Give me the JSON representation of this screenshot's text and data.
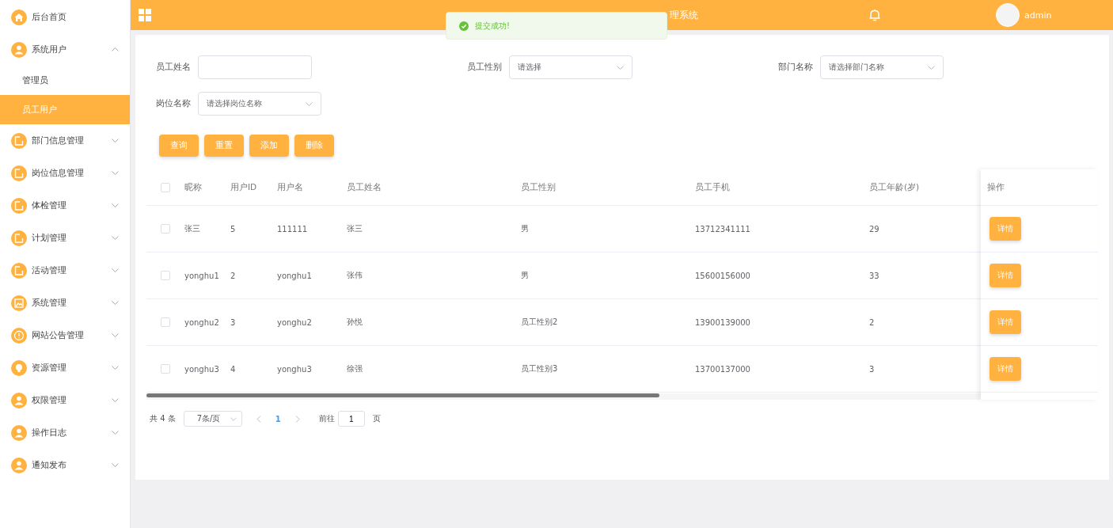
{
  "sidebar": {
    "items": [
      {
        "label": "后台首页",
        "kind": "home"
      },
      {
        "label": "系统用户",
        "kind": "user",
        "expanded": true,
        "children": [
          {
            "label": "管理员",
            "selected": false
          },
          {
            "label": "员工用户",
            "selected": true
          }
        ]
      },
      {
        "label": "部门信息管理",
        "kind": "note",
        "expanded": false
      },
      {
        "label": "岗位信息管理",
        "kind": "note",
        "expanded": false
      },
      {
        "label": "体检管理",
        "kind": "note",
        "expanded": false
      },
      {
        "label": "计划管理",
        "kind": "note",
        "expanded": false
      },
      {
        "label": "活动管理",
        "kind": "note",
        "expanded": false
      },
      {
        "label": "系统管理",
        "kind": "image",
        "expanded": false
      },
      {
        "label": "网站公告管理",
        "kind": "info",
        "expanded": false
      },
      {
        "label": "资源管理",
        "kind": "bulb",
        "expanded": false
      },
      {
        "label": "权限管理",
        "kind": "user",
        "expanded": false
      },
      {
        "label": "操作日志",
        "kind": "user",
        "expanded": false
      },
      {
        "label": "通知发布",
        "kind": "user",
        "expanded": false
      }
    ]
  },
  "header": {
    "title": "理系统",
    "user": "admin"
  },
  "toast": {
    "message": "提交成功!"
  },
  "filters": [
    {
      "label": "员工姓名",
      "kind": "input"
    },
    {
      "label": "员工性别",
      "kind": "select",
      "placeholder": "请选择"
    },
    {
      "label": "部门名称",
      "kind": "select",
      "placeholder": "请选择部门名称"
    },
    {
      "label": "岗位名称",
      "kind": "select",
      "placeholder": "请选择岗位名称"
    }
  ],
  "buttons": [
    "查询",
    "重置",
    "添加",
    "删除"
  ],
  "table": {
    "all_checked": false,
    "columns": [
      "昵称",
      "用户ID",
      "用户名",
      "员工姓名",
      "员工性别",
      "员工手机",
      "员工年龄(岁)",
      "操作"
    ],
    "rows": [
      {
        "checked": false,
        "cells": [
          "张三",
          "5",
          "111111",
          "张三",
          "男",
          "13712341111",
          "29"
        ],
        "action": "详情"
      },
      {
        "checked": false,
        "cells": [
          "yonghu1",
          "2",
          "yonghu1",
          "张伟",
          "男",
          "15600156000",
          "33"
        ],
        "action": "详情"
      },
      {
        "checked": false,
        "cells": [
          "yonghu2",
          "3",
          "yonghu2",
          "孙悦",
          "员工性别2",
          "13900139000",
          "2"
        ],
        "action": "详情"
      },
      {
        "checked": false,
        "cells": [
          "yonghu3",
          "4",
          "yonghu3",
          "徐强",
          "员工性别3",
          "13700137000",
          "3"
        ],
        "action": "详情"
      }
    ]
  },
  "pagination": {
    "total": "共 4 条",
    "page_size": "7条/页",
    "pages": [
      {
        "label": "1",
        "selected": true
      }
    ],
    "goto_label": "前往",
    "goto_value": "1",
    "goto_suffix": "页"
  }
}
